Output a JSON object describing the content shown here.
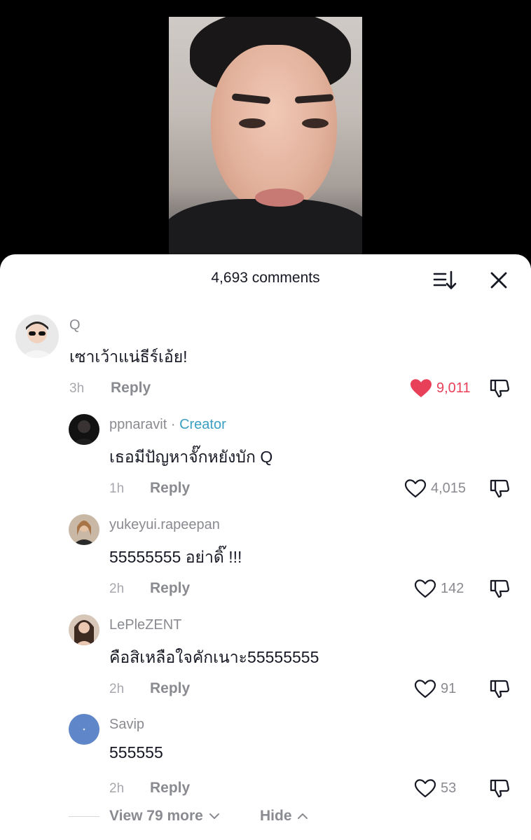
{
  "header": {
    "comments_count": "4,693 comments",
    "sort_icon": "sort-icon",
    "close_icon": "close-icon"
  },
  "colors": {
    "like_red": "#e9405a",
    "creator_blue": "#3a9fc2",
    "muted": "#8a8b91"
  },
  "comments": [
    {
      "username": "Q",
      "text": "เซาเว้าแน่ธีร์เอ้ย!",
      "time": "3h",
      "reply_label": "Reply",
      "likes": "9,011",
      "liked": true
    },
    {
      "username": "ppnaravit",
      "separator": " · ",
      "badge": "Creator",
      "text": "เธอมีปัญหาจั๊กหยังบัก Q",
      "time": "1h",
      "reply_label": "Reply",
      "likes": "4,015",
      "liked": false
    },
    {
      "username": "yukeyui.rapeepan",
      "text": "55555555 อย่าดิ๊ !!!",
      "time": "2h",
      "reply_label": "Reply",
      "likes": "142",
      "liked": false
    },
    {
      "username": "LePleZENT",
      "text": "คือสิเหลือใจคักเนาะ55555555",
      "time": "2h",
      "reply_label": "Reply",
      "likes": "91",
      "liked": false
    },
    {
      "username": "Savip",
      "text": "555555",
      "time": "2h",
      "reply_label": "Reply",
      "likes": "53",
      "liked": false
    }
  ],
  "footer": {
    "view_more": "View 79 more",
    "hide": "Hide"
  }
}
